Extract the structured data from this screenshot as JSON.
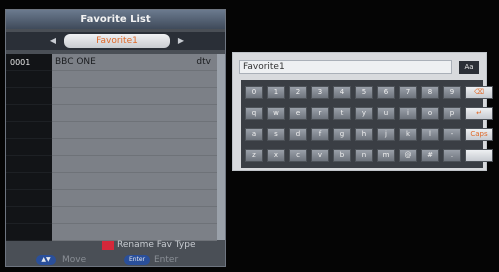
{
  "favorite_list": {
    "title": "Favorite List",
    "group_name": "Favorite1",
    "group_prev_arrow": "◀",
    "group_next_arrow": "▶",
    "channels": [
      {
        "number": "0001",
        "name": "BBC ONE",
        "type": "dtv"
      }
    ],
    "empty_rows": 10,
    "hint_color": "#d4283a",
    "hint_label": "Rename Fav Type",
    "nav": {
      "move_key": "▲▼",
      "move_label": "Move",
      "enter_key": "Enter",
      "enter_label": "Enter"
    }
  },
  "keyboard": {
    "input_value": "Favorite1",
    "case_button": "Aa",
    "rows": [
      [
        "0",
        "1",
        "2",
        "3",
        "4",
        "5",
        "6",
        "7",
        "8",
        "9",
        "⌫"
      ],
      [
        "q",
        "w",
        "e",
        "r",
        "t",
        "y",
        "u",
        "i",
        "o",
        "p",
        "↵"
      ],
      [
        "a",
        "s",
        "d",
        "f",
        "g",
        "h",
        "j",
        "k",
        "l",
        "-",
        "Caps"
      ],
      [
        "z",
        "x",
        "c",
        "v",
        "b",
        "n",
        "m",
        "@",
        "#",
        ".",
        " "
      ]
    ]
  },
  "colors": {
    "background": "#050505",
    "panel": "#4a4f56",
    "accent_orange": "#e06a2a",
    "key_blue": "#2a4f9a"
  },
  "icons": {
    "group_prev": "left-arrow-icon",
    "group_next": "right-arrow-icon",
    "backspace": "backspace-icon",
    "enter": "return-icon"
  }
}
